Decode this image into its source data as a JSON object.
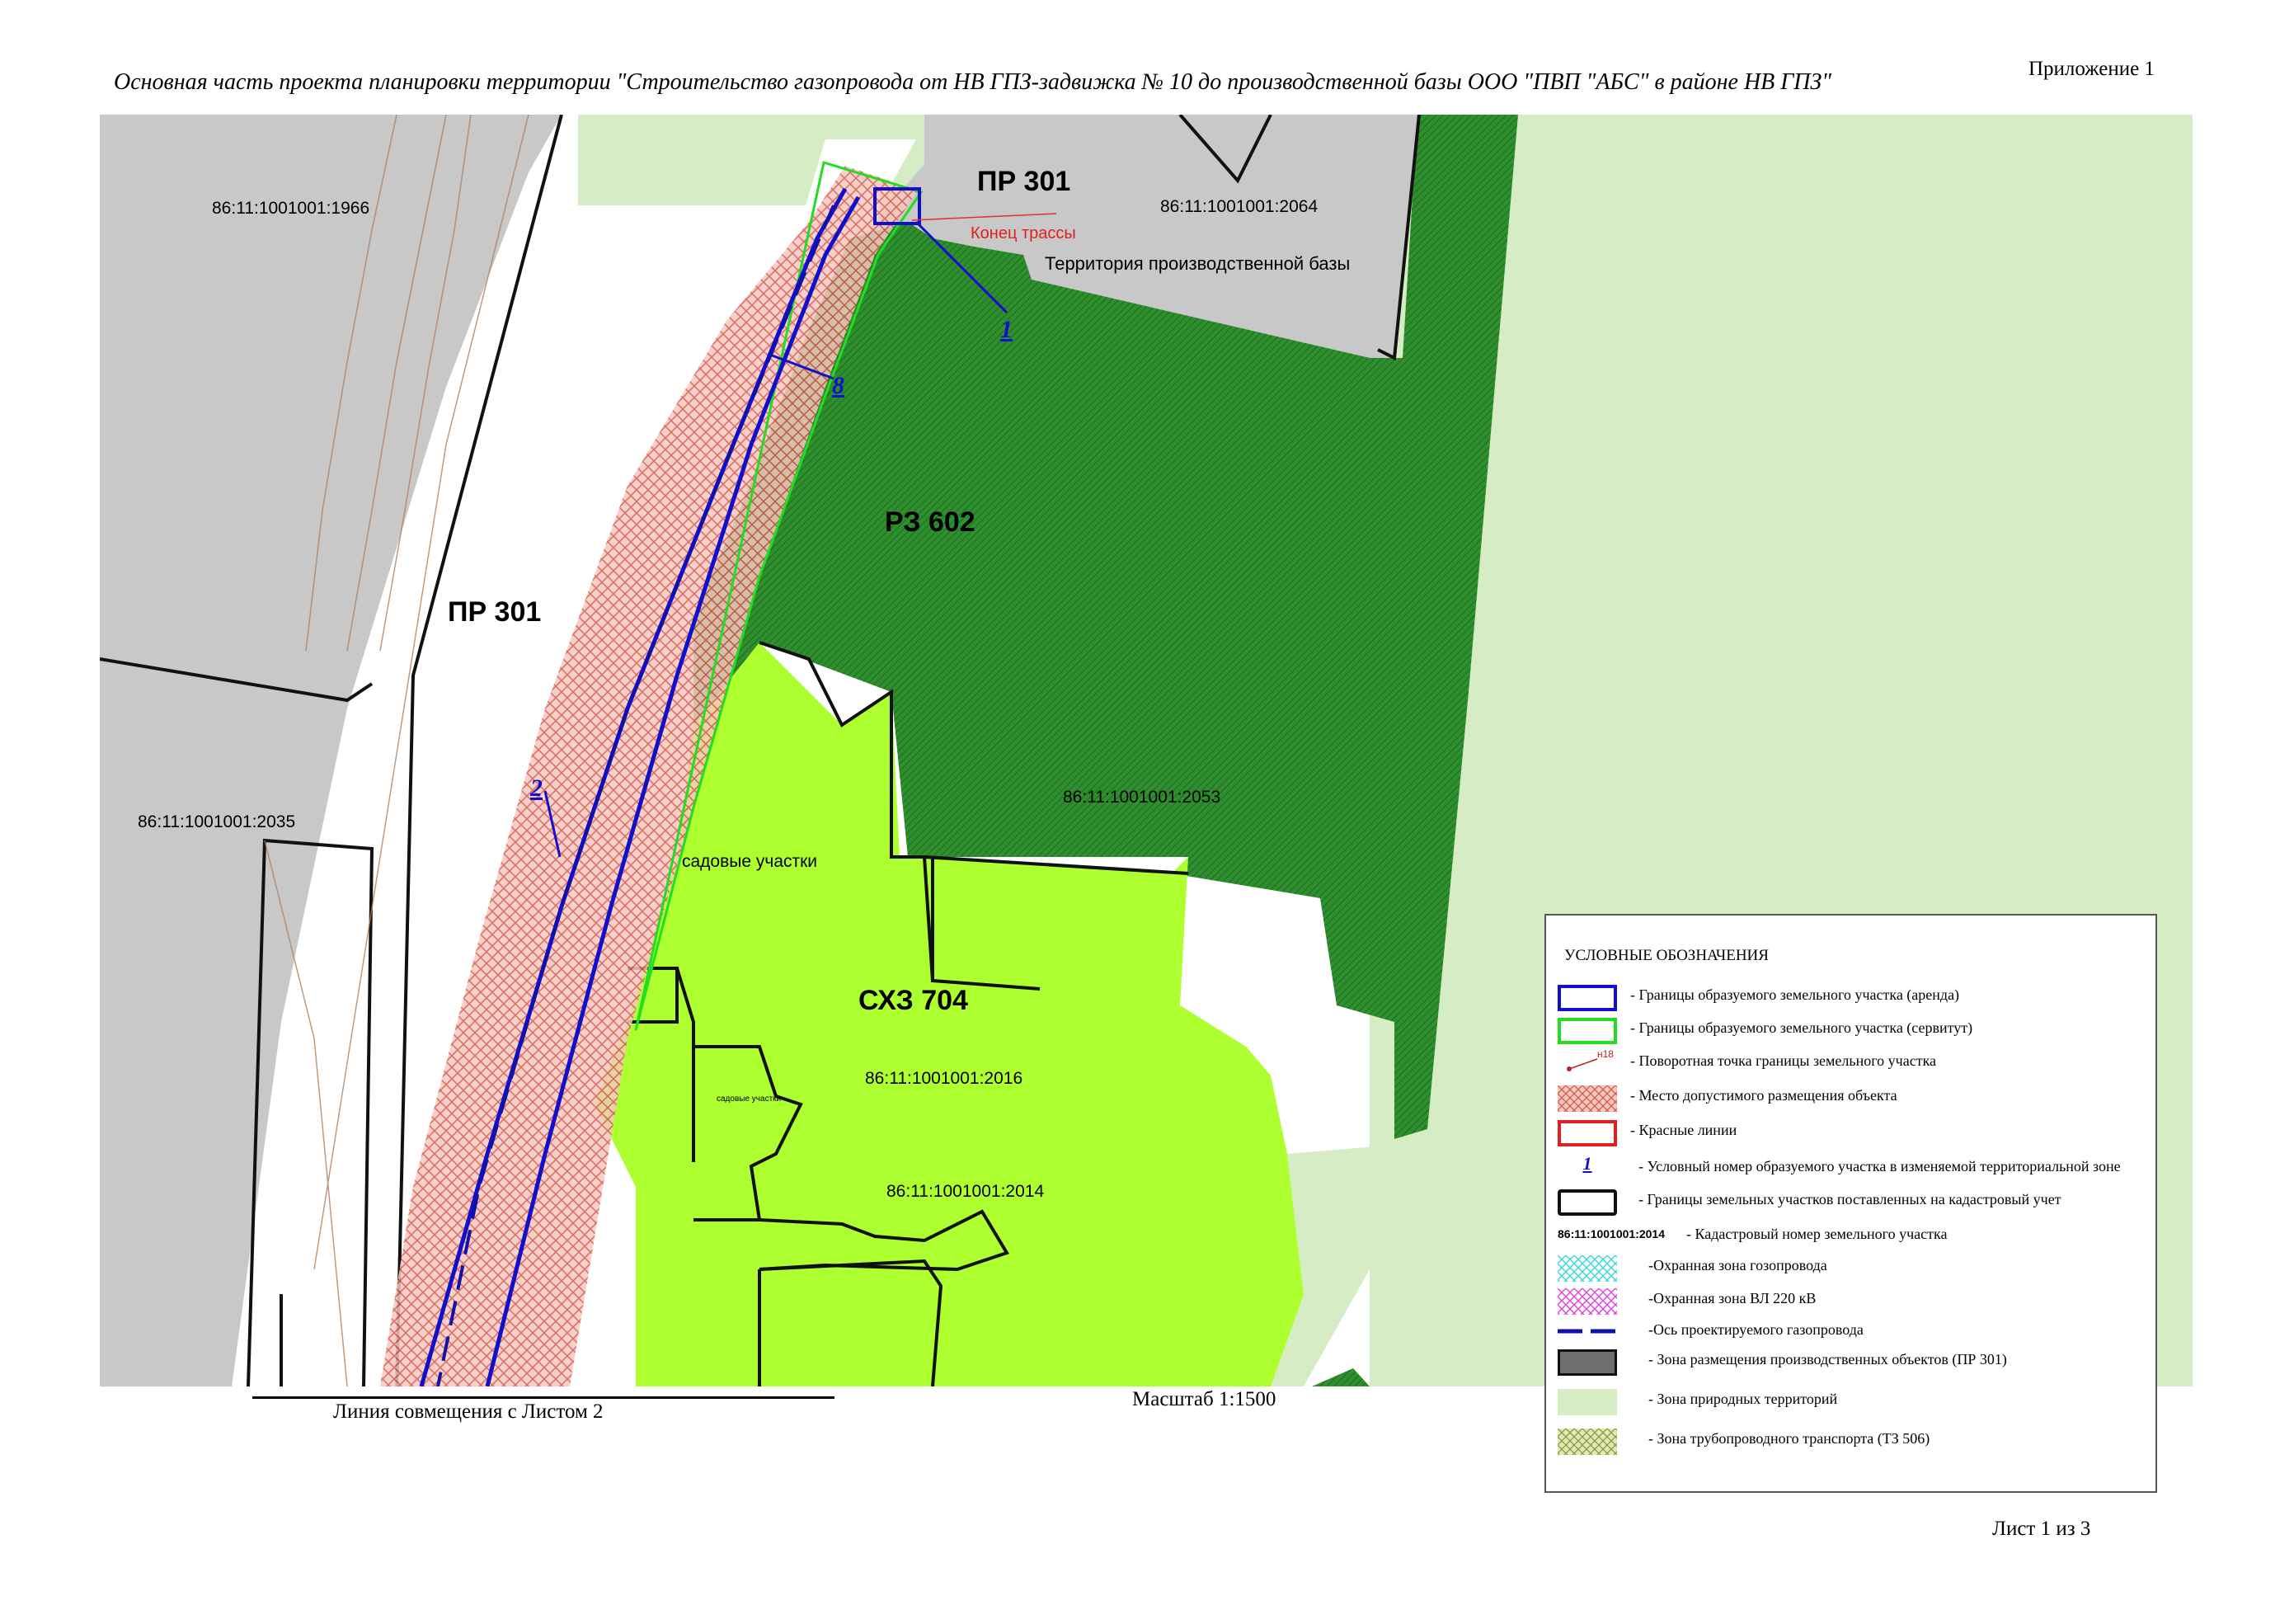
{
  "header": {
    "title": "Основная часть проекта планировки территории \"Строительство газопровода от НВ ГПЗ-задвижка № 10 до производственной базы ООО \"ПВП \"АБС\" в районе НВ ГПЗ\"",
    "appendix": "Приложение 1"
  },
  "footer": {
    "combine_line": "Линия совмещения с Листом 2",
    "scale": "Масштаб 1:1500",
    "sheet": "Лист 1 из 3"
  },
  "map": {
    "zones": {
      "pr301_top": "ПР 301",
      "pr301_left": "ПР 301",
      "rz602": "РЗ 602",
      "shz704": "СХЗ 704"
    },
    "cadastral": {
      "p1966": "86:11:1001001:1966",
      "p2064": "86:11:1001001:2064",
      "p2035": "86:11:1001001:2035",
      "p2053": "86:11:1001001:2053",
      "p2016": "86:11:1001001:2016",
      "p2014": "86:11:1001001:2014"
    },
    "texts": {
      "route_end": "Конец трассы",
      "base_territory": "Территория производственной базы",
      "gardens": "садовые участки",
      "gardens_small": "садовые участки"
    },
    "parcel_numbers": {
      "n1": "1",
      "n8": "8",
      "n2": "2"
    },
    "colors": {
      "industrial": "#c8c8c8",
      "recreation_hatch": "#2e8b2e",
      "agricultural": "#adff2f",
      "natural": "#d6ecc4",
      "lease_border": "#0000cc",
      "servitude_border": "#22dd22",
      "placement_hatch": "#e07070"
    }
  },
  "legend": {
    "title": "УСЛОВНЫЕ ОБОЗНАЧЕНИЯ",
    "items": [
      {
        "text": "- Границы образуемого земельного участка (аренда)",
        "symbol": "blue-border"
      },
      {
        "text": "- Границы образуемого земельного участка  (сервитут)",
        "symbol": "green-border"
      },
      {
        "text": "- Поворотная точка границы земельного участка",
        "symbol": "turn-point",
        "sample": "н18"
      },
      {
        "text": "- Место допустимого размещения объекта",
        "symbol": "red-hatch"
      },
      {
        "text": "- Красные линии",
        "symbol": "red-border"
      },
      {
        "text": "- Условный номер образуемого участка в изменяемой территориальной зоне",
        "symbol": "number",
        "sample": "1"
      },
      {
        "text": "- Границы земельных участков поставленных на кадастровый учет",
        "symbol": "black-border"
      },
      {
        "text": "- Кадастровый номер земельного участка",
        "symbol": "cadastral",
        "sample": "86:11:1001001:2014"
      },
      {
        "text": "-Охранная зона гозопровода",
        "symbol": "cyan-hatch"
      },
      {
        "text": "-Охранная зона ВЛ 220 кВ",
        "symbol": "magenta-hatch"
      },
      {
        "text": "-Ось проектируемого газопровода",
        "symbol": "axis"
      },
      {
        "text": "- Зона размещения производственных объектов (ПР 301)",
        "symbol": "grey-fill"
      },
      {
        "text": "- Зона природных территорий",
        "symbol": "natural-fill"
      },
      {
        "text": "- Зона трубопроводного транспорта (ТЗ 506)",
        "symbol": "olive-hatch"
      }
    ]
  }
}
